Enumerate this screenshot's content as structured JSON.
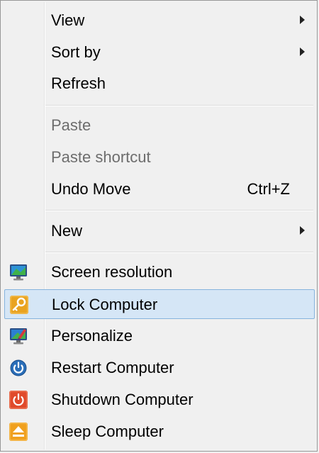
{
  "menu": {
    "items": [
      {
        "label": "View",
        "submenu": true
      },
      {
        "label": "Sort by",
        "submenu": true
      },
      {
        "label": "Refresh"
      },
      {
        "label": "Paste",
        "disabled": true
      },
      {
        "label": "Paste shortcut",
        "disabled": true
      },
      {
        "label": "Undo Move",
        "shortcut": "Ctrl+Z"
      },
      {
        "label": "New",
        "submenu": true
      },
      {
        "label": "Screen resolution",
        "icon": "monitor-icon"
      },
      {
        "label": "Lock Computer",
        "icon": "key-icon",
        "highlighted": true
      },
      {
        "label": "Personalize",
        "icon": "personalize-monitor-icon"
      },
      {
        "label": "Restart Computer",
        "icon": "restart-icon"
      },
      {
        "label": "Shutdown Computer",
        "icon": "power-icon"
      },
      {
        "label": "Sleep Computer",
        "icon": "eject-sleep-icon"
      }
    ]
  },
  "colors": {
    "menu_background": "#f0f0f0",
    "highlight_fill": "#d5e6f6",
    "highlight_border": "#86b3dd",
    "disabled_text": "#6d6d6d"
  }
}
